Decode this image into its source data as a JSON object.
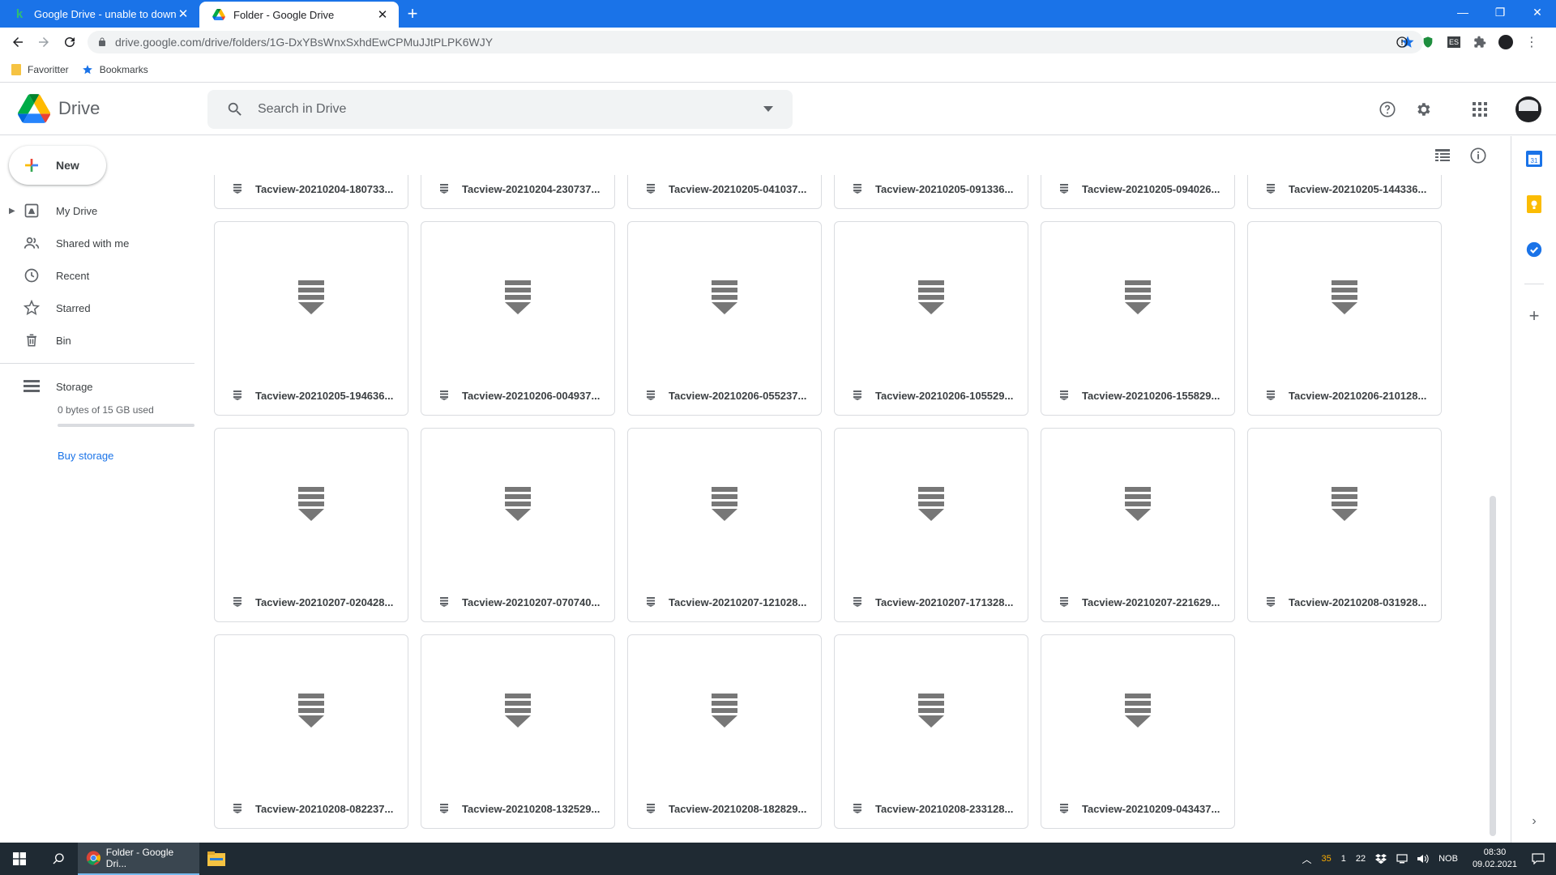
{
  "browser": {
    "tabs": [
      {
        "title": "Google Drive - unable to downlo",
        "active": false,
        "favicon": "k-favicon"
      },
      {
        "title": "Folder - Google Drive",
        "active": true,
        "favicon": "drive-favicon"
      }
    ],
    "url": "drive.google.com/drive/folders/1G-DxYBsWnxSxhdEwCPMuJJtPLPK6WJY",
    "bookmarks": [
      {
        "label": "Favoritter",
        "icon": "folder-icon"
      },
      {
        "label": "Bookmarks",
        "icon": "star-icon"
      }
    ],
    "extensions": [
      {
        "label": "ES"
      }
    ]
  },
  "header": {
    "app_name": "Drive",
    "search_placeholder": "Search in Drive"
  },
  "sidebar": {
    "new_label": "New",
    "items": [
      {
        "label": "My Drive",
        "icon": "my-drive-icon"
      },
      {
        "label": "Shared with me",
        "icon": "people-icon"
      },
      {
        "label": "Recent",
        "icon": "clock-icon"
      },
      {
        "label": "Starred",
        "icon": "star-outline-icon"
      },
      {
        "label": "Bin",
        "icon": "trash-icon"
      }
    ],
    "storage_label": "Storage",
    "storage_used": "0 bytes of 15 GB used",
    "storage_fraction": 0,
    "buy_storage": "Buy storage"
  },
  "files": [
    "Tacview-20210204-180733...",
    "Tacview-20210204-230737...",
    "Tacview-20210205-041037...",
    "Tacview-20210205-091336...",
    "Tacview-20210205-094026...",
    "Tacview-20210205-144336...",
    "Tacview-20210205-194636...",
    "Tacview-20210206-004937...",
    "Tacview-20210206-055237...",
    "Tacview-20210206-105529...",
    "Tacview-20210206-155829...",
    "Tacview-20210206-210128...",
    "Tacview-20210207-020428...",
    "Tacview-20210207-070740...",
    "Tacview-20210207-121028...",
    "Tacview-20210207-171328...",
    "Tacview-20210207-221629...",
    "Tacview-20210208-031928...",
    "Tacview-20210208-082237...",
    "Tacview-20210208-132529...",
    "Tacview-20210208-182829...",
    "Tacview-20210208-233128...",
    "Tacview-20210209-043437..."
  ],
  "taskbar": {
    "active_app": "Folder - Google Dri...",
    "tray_numbers": [
      "35",
      "1",
      "22"
    ],
    "language": "NOB",
    "time": "08:30",
    "date": "09.02.2021"
  },
  "colors": {
    "accent": "#1a73e8",
    "taskbar": "#1f2a33"
  }
}
